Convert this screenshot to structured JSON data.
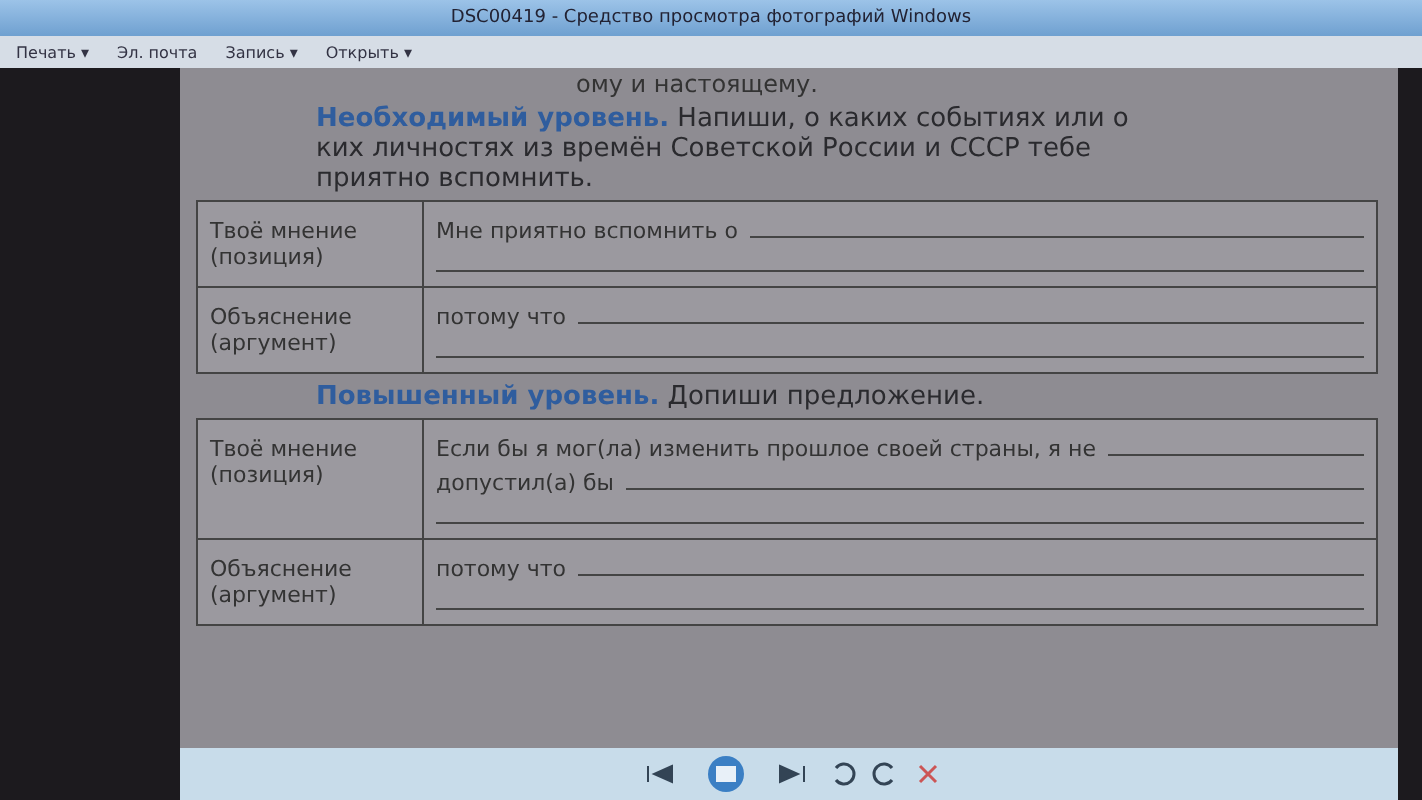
{
  "window": {
    "title": "DSC00419 - Средство просмотра фотографий Windows"
  },
  "menu": [
    "Печать ▾",
    "Эл. почта",
    "Запись ▾",
    "Открыть ▾"
  ],
  "page": {
    "cut_line": "ому и настоящему.",
    "sections": [
      {
        "level": "Необходимый уровень.",
        "task": "Напиши, о каких событиях или о",
        "task_lines": [
          "ких личностях из времён Советской России и СССР тебе",
          "приятно вспомнить."
        ],
        "rows": [
          {
            "label": [
              "Твоё мнение",
              "(позиция)"
            ],
            "start": "Мне приятно вспомнить о"
          },
          {
            "label": [
              "Объяснение",
              "(аргумент)"
            ],
            "start": "потому что"
          }
        ]
      },
      {
        "level": "Повышенный уровень.",
        "task": "Допиши предложение.",
        "rows": [
          {
            "label": [
              "Твоё мнение",
              "(позиция)"
            ],
            "start": "Если бы я мог(ла) изменить прошлое своей страны, я не",
            "cont": "допустил(а) бы"
          },
          {
            "label": [
              "Объяснение",
              "(аргумент)"
            ],
            "start": "потому что"
          }
        ]
      }
    ]
  }
}
